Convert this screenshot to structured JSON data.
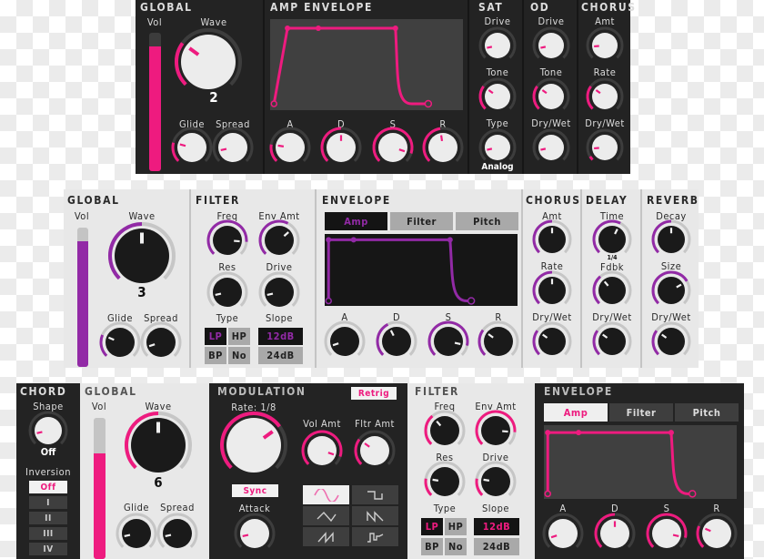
{
  "colors": {
    "pink": "#ee1b7f",
    "purple": "#922aa6",
    "dark_bg": "#232323",
    "light_bg": "#e8e8e8"
  },
  "top_panel": {
    "global": {
      "title": "GLOBAL",
      "vol_label": "Vol",
      "vol_level": 0.9,
      "wave_label": "Wave",
      "wave_value": "2",
      "glide_label": "Glide",
      "spread_label": "Spread"
    },
    "amp_envelope": {
      "title": "AMP ENVELOPE",
      "knobs": [
        "A",
        "D",
        "S",
        "R"
      ]
    },
    "sat": {
      "title": "SAT",
      "drive_label": "Drive",
      "tone_label": "Tone",
      "type_label": "Type",
      "type_value": "Analog"
    },
    "od": {
      "title": "OD",
      "drive_label": "Drive",
      "tone_label": "Tone",
      "drywet_label": "Dry/Wet"
    },
    "chorus": {
      "title": "CHORUS",
      "amt_label": "Amt",
      "rate_label": "Rate",
      "drywet_label": "Dry/Wet"
    }
  },
  "middle_panel": {
    "global": {
      "title": "GLOBAL",
      "vol_label": "Vol",
      "vol_level": 0.9,
      "wave_label": "Wave",
      "wave_value": "3",
      "glide_label": "Glide",
      "spread_label": "Spread"
    },
    "filter": {
      "title": "FILTER",
      "freq_label": "Freq",
      "envamt_label": "Env Amt",
      "res_label": "Res",
      "drive_label": "Drive",
      "type_label": "Type",
      "slope_label": "Slope",
      "types": [
        "LP",
        "HP",
        "BP",
        "No"
      ],
      "selected_type": "LP",
      "slopes": [
        "12dB",
        "24dB"
      ],
      "selected_slope": "12dB"
    },
    "envelope": {
      "title": "ENVELOPE",
      "tabs": [
        "Amp",
        "Filter",
        "Pitch"
      ],
      "active_tab": "Amp",
      "knobs": [
        "A",
        "D",
        "S",
        "R"
      ]
    },
    "chorus": {
      "title": "CHORUS",
      "amt_label": "Amt",
      "rate_label": "Rate",
      "drywet_label": "Dry/Wet"
    },
    "delay": {
      "title": "DELAY",
      "time_label": "Time",
      "time_value": "1/4",
      "fdbk_label": "Fdbk",
      "drywet_label": "Dry/Wet"
    },
    "reverb": {
      "title": "REVERB",
      "decay_label": "Decay",
      "size_label": "Size",
      "drywet_label": "Dry/Wet"
    }
  },
  "bottom_panel": {
    "chord": {
      "title": "CHORD",
      "shape_label": "Shape",
      "shape_value": "Off",
      "inversion_label": "Inversion",
      "inversions": [
        "Off",
        "I",
        "II",
        "III",
        "IV"
      ],
      "selected_inversion": "Off"
    },
    "global": {
      "title": "GLOBAL",
      "vol_label": "Vol",
      "vol_level": 0.75,
      "wave_label": "Wave",
      "wave_value": "6",
      "glide_label": "Glide",
      "spread_label": "Spread"
    },
    "modulation": {
      "title": "MODULATION",
      "retrig_label": "Retrig",
      "rate_label": "Rate: 1/8",
      "volamt_label": "Vol Amt",
      "fltramt_label": "Fltr Amt",
      "sync_label": "Sync",
      "attack_label": "Attack",
      "waveforms": [
        "sine",
        "square",
        "triangle",
        "saw-down",
        "saw-up",
        "random"
      ],
      "selected_waveform": "sine"
    },
    "filter": {
      "title": "FILTER",
      "freq_label": "Freq",
      "envamt_label": "Env Amt",
      "res_label": "Res",
      "drive_label": "Drive",
      "type_label": "Type",
      "slope_label": "Slope",
      "types": [
        "LP",
        "HP",
        "BP",
        "No"
      ],
      "selected_type": "LP",
      "slopes": [
        "12dB",
        "24dB"
      ],
      "selected_slope": "12dB"
    },
    "envelope": {
      "title": "ENVELOPE",
      "tabs": [
        "Amp",
        "Filter",
        "Pitch"
      ],
      "active_tab": "Amp",
      "knobs": [
        "A",
        "D",
        "S",
        "R"
      ]
    }
  }
}
